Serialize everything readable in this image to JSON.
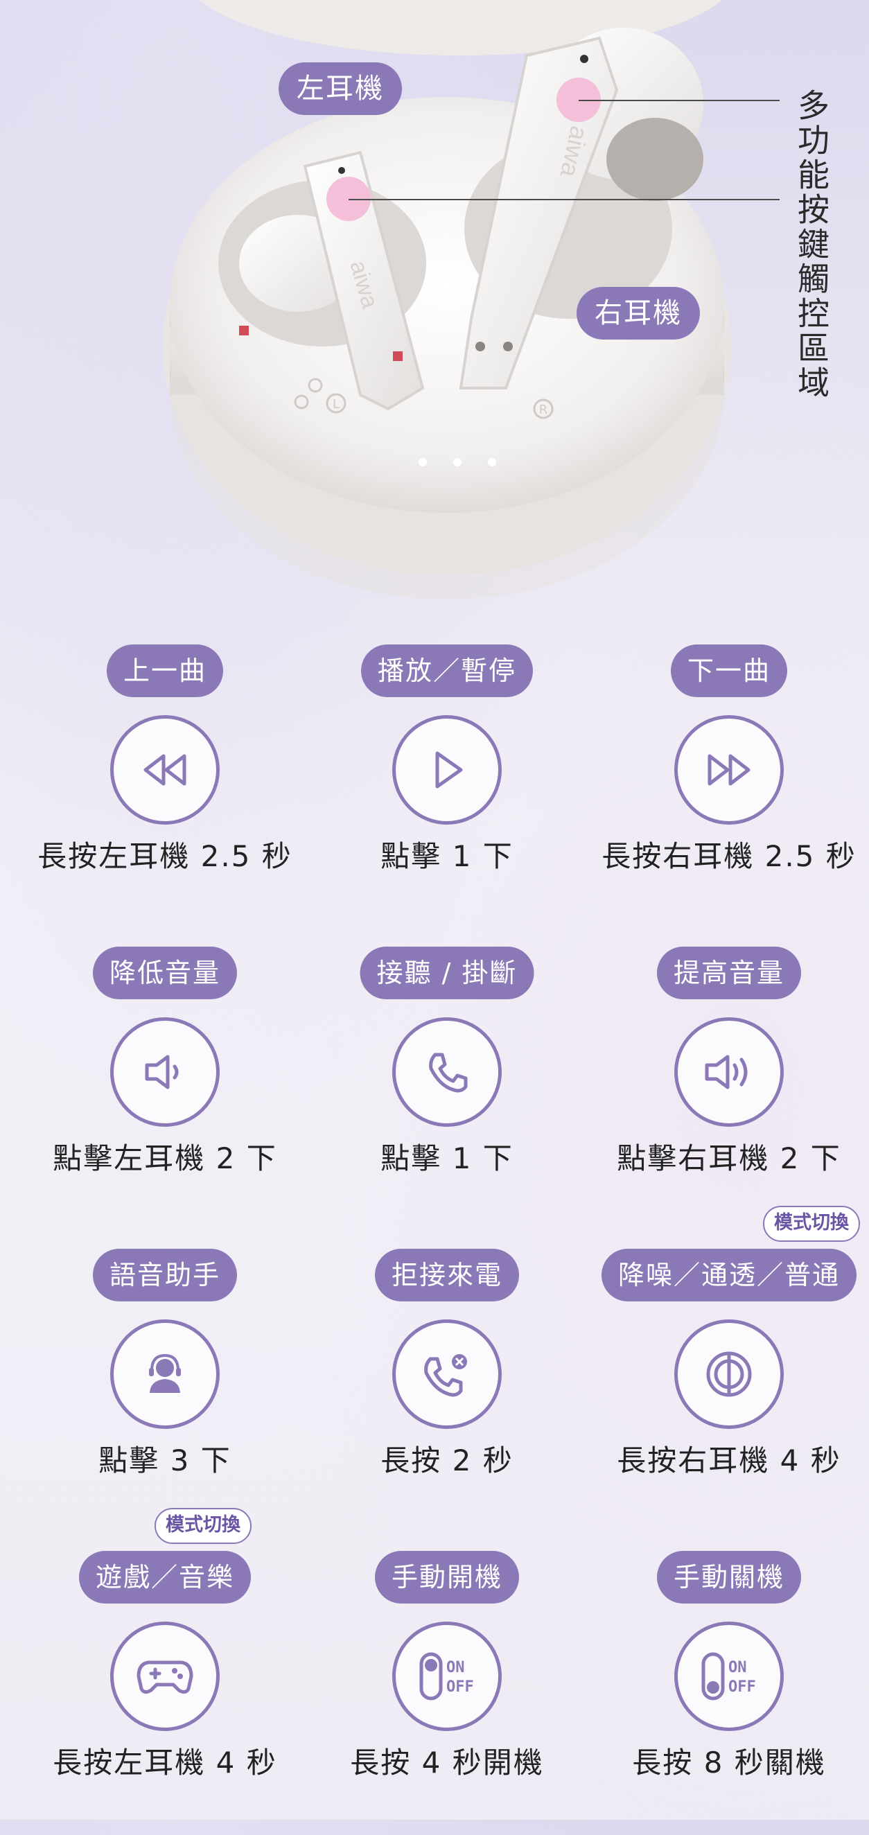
{
  "hero": {
    "left_label": "左耳機",
    "right_label": "右耳機",
    "touch_area_label": "多功能按鍵觸控區域",
    "brand": "aiwa",
    "case_left_mark": "L",
    "case_right_mark": "R"
  },
  "controls": [
    {
      "label": "上一曲",
      "desc": "長按左耳機 2.5 秒",
      "icon": "previous-track-icon"
    },
    {
      "label": "播放／暫停",
      "desc": "點擊 1 下",
      "icon": "play-icon"
    },
    {
      "label": "下一曲",
      "desc": "長按右耳機 2.5 秒",
      "icon": "next-track-icon"
    },
    {
      "label": "降低音量",
      "desc": "點擊左耳機 2 下",
      "icon": "volume-down-icon"
    },
    {
      "label": "接聽 / 掛斷",
      "desc": "點擊 1 下",
      "icon": "phone-icon"
    },
    {
      "label": "提高音量",
      "desc": "點擊右耳機 2 下",
      "icon": "volume-up-icon"
    },
    {
      "label": "語音助手",
      "desc": "點擊 3 下",
      "icon": "voice-assistant-icon"
    },
    {
      "label": "拒接來電",
      "desc": "長按 2 秒",
      "icon": "reject-call-icon"
    },
    {
      "label": "降噪／通透／普通",
      "desc": "長按右耳機 4 秒",
      "icon": "noise-cancel-icon",
      "badge": "模式切換"
    },
    {
      "label": "遊戲／音樂",
      "desc": "長按左耳機 4 秒",
      "icon": "gamepad-icon",
      "badge": "模式切換"
    },
    {
      "label": "手動開機",
      "desc": "長按 4 秒開機",
      "icon": "power-on-icon"
    },
    {
      "label": "手動關機",
      "desc": "長按 8 秒關機",
      "icon": "power-off-icon"
    }
  ],
  "switch_text": {
    "on": "ON",
    "off": "OFF"
  },
  "colors": {
    "accent": "#8b78b6",
    "touch_dot": "#f4b9d6"
  }
}
